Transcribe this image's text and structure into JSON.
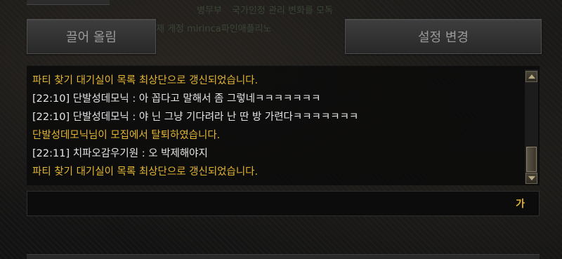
{
  "background_overlay": {
    "line1": "병무부",
    "line2": "국가인정 관리 변화를 모독",
    "line3": "제 게정 mirinca파인애플리노"
  },
  "buttons": {
    "pull_up_label": "끌어 올림",
    "settings_label": "설정 변경"
  },
  "chat": {
    "lines": [
      {
        "type": "system",
        "text": "파티 찾기 대기실이 목록 최상단으로 갱신되었습니다."
      },
      {
        "type": "user",
        "text": "[22:10] 단발성데모닉 : 아 꼽다고 말해서 좀 그렇네ㅋㅋㅋㅋㅋㅋㅋ"
      },
      {
        "type": "user",
        "text": "[22:10] 단발성데모닉 : 야  닌 그냥 기다려라 난 딴 방 가련다ㅋㅋㅋㅋㅋㅋㅋ"
      },
      {
        "type": "system",
        "text": "단발성데모닉님이 모집에서 탈퇴하였습니다."
      },
      {
        "type": "user",
        "text": "[22:11] 치파오감우기원 : 오 박제해야지"
      },
      {
        "type": "system",
        "text": "파티 찾기 대기실이 목록 최상단으로 갱신되었습니다."
      }
    ]
  },
  "input": {
    "value": "",
    "ime_indicator": "가"
  },
  "colors": {
    "system_text": "#e3b530",
    "user_text": "#e6e6e6",
    "button_text": "#9a9a9a"
  }
}
